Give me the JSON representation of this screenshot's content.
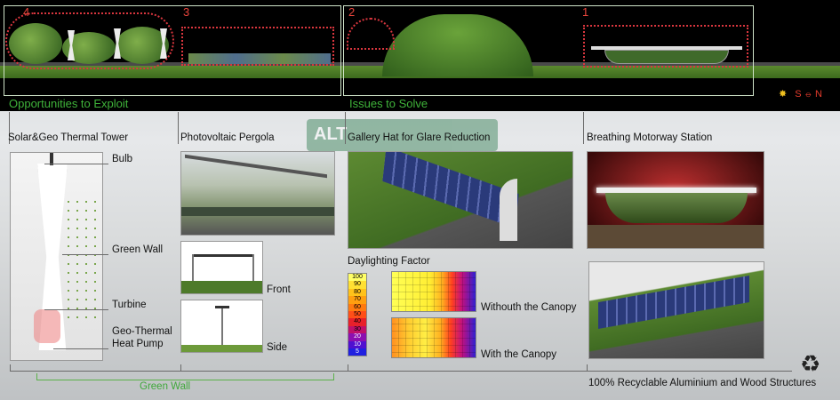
{
  "panorama": {
    "section_numbers": [
      "4",
      "3",
      "2",
      "1"
    ],
    "left_caption": "Opportunities to Exploit",
    "right_caption": "Issues to Solve",
    "compass": {
      "s": "S",
      "n": "N"
    }
  },
  "background_sign": "ALT",
  "columns": {
    "tower": {
      "title": "Solar&Geo Thermal Tower",
      "labels": {
        "bulb": "Bulb",
        "green_wall": "Green Wall",
        "turbine": "Turbine",
        "heat_pump": [
          "Geo-Thermal",
          "Heat Pump"
        ]
      }
    },
    "pergola": {
      "title": "Photovoltaic Pergola",
      "views": {
        "front": "Front",
        "side": "Side"
      }
    },
    "gallery": {
      "title": "Gallery Hat for Glare Reduction",
      "daylighting_title": "Daylighting Factor",
      "scale": [
        "100",
        "90",
        "80",
        "70",
        "60",
        "50",
        "40",
        "30",
        "20",
        "10",
        "5"
      ],
      "scale_colors": [
        "#ffff66",
        "#ffe033",
        "#ffc21a",
        "#ff9f10",
        "#ff7a10",
        "#ff4f18",
        "#e8202a",
        "#c0106a",
        "#8c10b0",
        "#5010d0",
        "#2020e0"
      ],
      "without_label": "Withouth the Canopy",
      "with_label": "With the Canopy"
    },
    "station": {
      "title": "Breathing Motorway Station"
    }
  },
  "footer": {
    "green_wall": "Green Wall",
    "recyclable": "100% Recyclable Aluminium and Wood Structures",
    "recycle_icon": "recycle-icon"
  }
}
